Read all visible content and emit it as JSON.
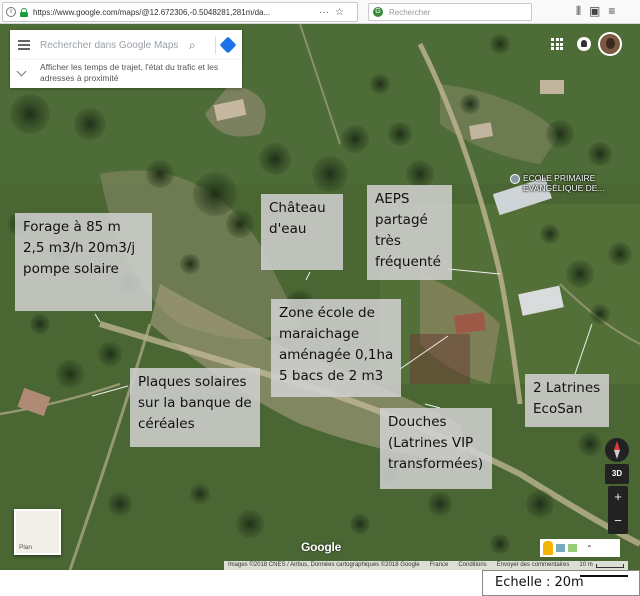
{
  "browser": {
    "url": "https://www.google.com/maps/@12.672306,-0.5048281,281m/da...",
    "search_placeholder": "Rechercher"
  },
  "maps_ui": {
    "search_placeholder": "Rechercher dans Google Maps",
    "expand_hint": "Afficher les temps de trajet, l'état du trafic et les adresses à proximité",
    "poi_label_line1": "ECOLE PRIMAIRE",
    "poi_label_line2": "EVANGÉLIQUE DE...",
    "btn_3d": "3D",
    "zoom_in": "+",
    "zoom_out": "−",
    "plan_label": "Plan",
    "google_logo": "Google",
    "attribution": "Images ©2018 CNES / Airbus, Données cartographiques ©2018 Google",
    "footer_france": "France",
    "footer_conditions": "Conditions",
    "footer_feedback": "Envoyer des commentaires",
    "footer_scale": "10 m"
  },
  "annotations": {
    "forage": [
      "Forage à 85 m",
      "2,5 m3/h   20m3/j",
      "pompe solaire"
    ],
    "chateau": [
      "Château",
      "d'eau"
    ],
    "aeps": [
      "AEPS",
      "partagé",
      "très",
      "fréquenté"
    ],
    "zone_ecole": [
      "Zone école de",
      "maraichage",
      "aménagée 0,1ha",
      "5 bacs de 2 m3"
    ],
    "plaques": [
      "Plaques solaires",
      "sur la banque de",
      "céréales"
    ],
    "douches": [
      "Douches",
      "(Latrines VIP",
      "transformées)"
    ],
    "latrines": [
      "2 Latrines",
      "EcoSan"
    ]
  },
  "scale_label": "Echelle : 20m"
}
